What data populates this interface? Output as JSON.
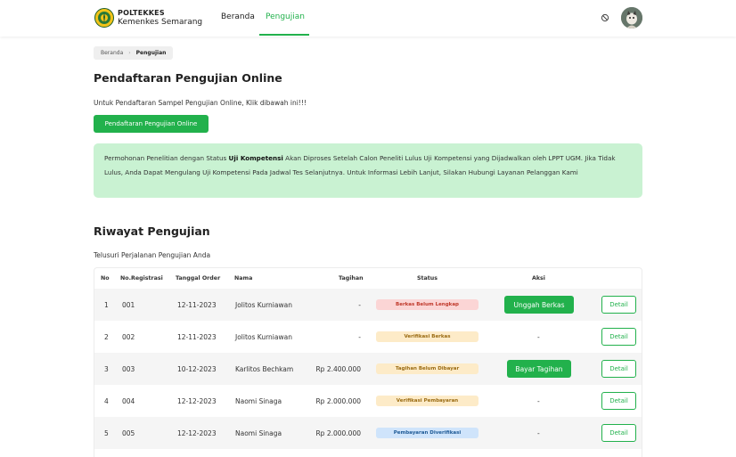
{
  "navbar": {
    "brand_line1": "POLTEKKES",
    "brand_line2": "Kemenkes Semarang",
    "nav": [
      "Beranda",
      "Pengujian"
    ],
    "active_index": 1,
    "accent_color": "#22b14c",
    "theme_icon": "circle-slash-icon",
    "avatar_icon": "avatar-icon"
  },
  "breadcrumb": [
    "Beranda",
    "Pengujian"
  ],
  "registration": {
    "title": "Pendaftaran Pengujian Online",
    "intro": "Untuk Pendaftaran Sampel Pengujian Online, Klik dibawah ini!!!",
    "button_label": "Pendaftaran Pengujian Online"
  },
  "notice": {
    "before_bold": "Permohonan Penelitian dengan Status ",
    "bold": "Uji Kompetensi",
    "after_bold": " Akan Diproses Setelah Calon Peneliti Lulus Uji Kompetensi yang Dijadwalkan oleh LPPT UGM. Jika Tidak Lulus, Anda Dapat Mengulang Uji Kompetensi Pada Jadwal Tes Selanjutnya. Untuk Informasi Lebih Lanjut, Silakan Hubungi Layanan Pelanggan Kami",
    "background": "#c9f2d2"
  },
  "history": {
    "title": "Riwayat Pengujian",
    "subtitle": "Telusuri Perjalanan Pengujian Anda",
    "columns": [
      "No",
      "No.Registrasi",
      "Tanggal Order",
      "Nama",
      "Tagihan",
      "Status",
      "Aksi"
    ],
    "rows": [
      {
        "no": "1",
        "reg": "001",
        "date": "12-11-2023",
        "name": "Jolitos Kurniawan",
        "bill": "-",
        "status": "Berkas Belum Lengkap",
        "status_bg": "#fbd5d5",
        "status_fg": "#c0392b",
        "action": "Unggah Berkas",
        "detail": "Detail"
      },
      {
        "no": "2",
        "reg": "002",
        "date": "12-11-2023",
        "name": "Jolitos Kurniawan",
        "bill": "-",
        "status": "Verifikasi Berkas",
        "status_bg": "#fdebc8",
        "status_fg": "#9a6b12",
        "action": "-",
        "detail": "Detail"
      },
      {
        "no": "3",
        "reg": "003",
        "date": "10-12-2023",
        "name": "Karlitos Bechkam",
        "bill": "Rp 2.400.000",
        "status": "Tagihan Belum Dibayar",
        "status_bg": "#fdebc8",
        "status_fg": "#9a6b12",
        "action": "Bayar Tagihan",
        "detail": "Detail"
      },
      {
        "no": "4",
        "reg": "004",
        "date": "12-12-2023",
        "name": "Naomi Sinaga",
        "bill": "Rp 2.000.000",
        "status": "Verifikasi Pembayaran",
        "status_bg": "#fdebc8",
        "status_fg": "#9a6b12",
        "action": "-",
        "detail": "Detail"
      },
      {
        "no": "5",
        "reg": "005",
        "date": "12-12-2023",
        "name": "Naomi Sinaga",
        "bill": "Rp 2.000.000",
        "status": "Pembayaran Diverifikasi",
        "status_bg": "#cfe4fb",
        "status_fg": "#1e5a96",
        "action": "-",
        "detail": "Detail"
      }
    ]
  }
}
